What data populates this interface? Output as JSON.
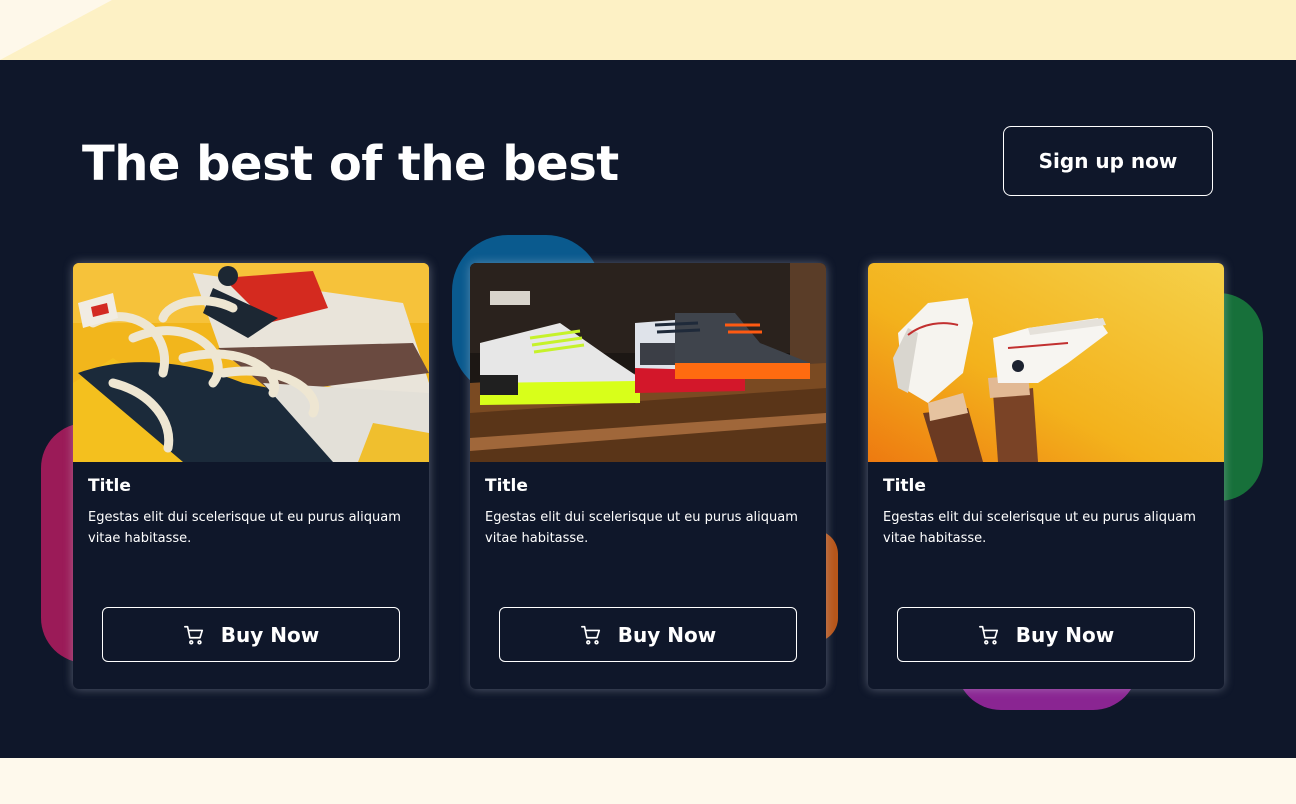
{
  "hero": {
    "heading": "The best of the best",
    "signup_label": "Sign up now"
  },
  "cards": [
    {
      "image": "sneakers-yellow-closeup-photo",
      "title": "Title",
      "description": "Egestas elit dui scelerisque ut eu purus aliquam vitae habitasse.",
      "button_label": "Buy Now",
      "button_icon": "cart-icon"
    },
    {
      "image": "sneakers-on-shelf-photo",
      "title": "Title",
      "description": "Egestas elit dui scelerisque ut eu purus aliquam vitae habitasse.",
      "button_label": "Buy Now",
      "button_icon": "cart-icon"
    },
    {
      "image": "white-hightops-yellow-wall-photo",
      "title": "Title",
      "description": "Egestas elit dui scelerisque ut eu purus aliquam vitae habitasse.",
      "button_label": "Buy Now",
      "button_icon": "cart-icon"
    }
  ],
  "colors": {
    "hero_background": "#0f172a",
    "text": "#ffffff",
    "top_band": "#fdf1c5",
    "blob_pink": "#9b1b58",
    "blob_blue": "#0a5a8e",
    "blob_orange": "#b7561a",
    "blob_green": "#17703a",
    "blob_purple": "#8a2592"
  }
}
